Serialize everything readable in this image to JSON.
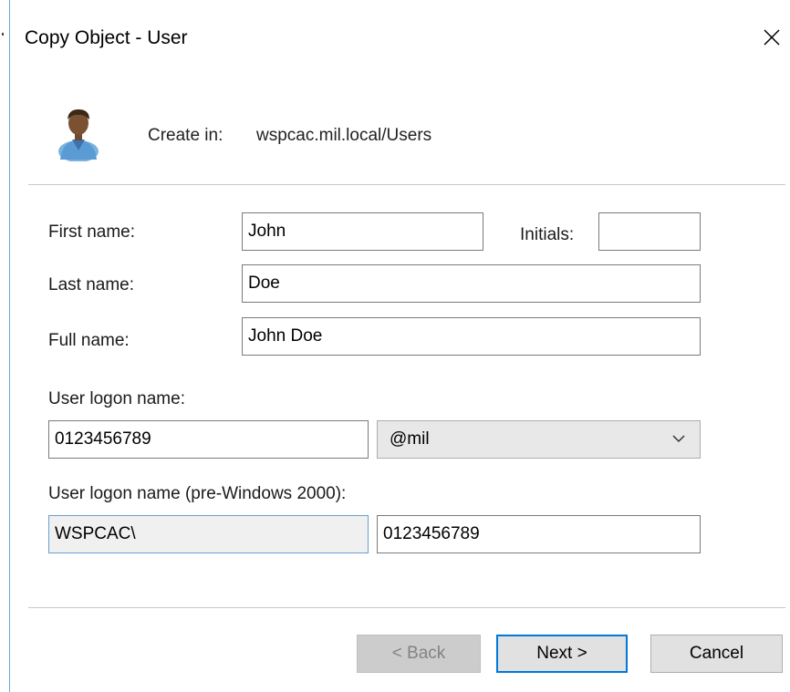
{
  "window": {
    "title": "Copy Object - User",
    "close_glyph": "✕"
  },
  "header": {
    "icon": "user-icon",
    "create_in_label": "Create in:",
    "create_in_value": "wspcac.mil.local/Users"
  },
  "form": {
    "first_name": {
      "label": "First name:",
      "value": "John"
    },
    "initials": {
      "label": "Initials:",
      "value": ""
    },
    "last_name": {
      "label": "Last name:",
      "value": "Doe"
    },
    "full_name": {
      "label": "Full name:",
      "value": "John Doe"
    },
    "logon_name": {
      "label": "User logon name:",
      "value": "0123456789",
      "domain_suffix": "@mil"
    },
    "pre2000": {
      "label": "User logon name (pre-Windows 2000):",
      "domain": "WSPCAC\\",
      "value": "0123456789"
    }
  },
  "buttons": {
    "back": "< Back",
    "next": "Next >",
    "cancel": "Cancel"
  },
  "colors": {
    "accent": "#0078d7",
    "window_border": "#6fa5dc"
  }
}
